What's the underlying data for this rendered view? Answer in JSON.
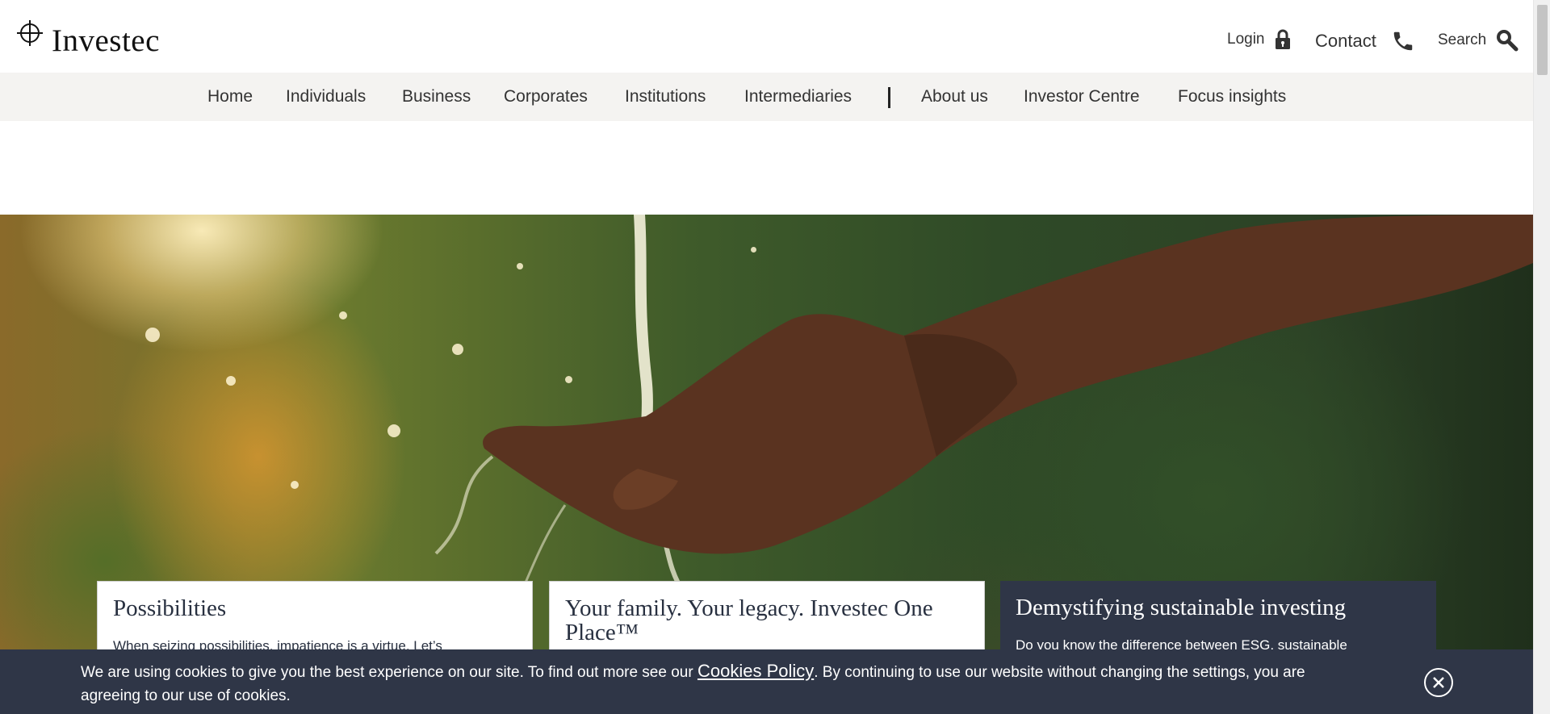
{
  "header": {
    "logo_text": "Investec",
    "login_label": "Login",
    "contact_label": "Contact",
    "search_label": "Search"
  },
  "nav": {
    "items": [
      {
        "label": "Home"
      },
      {
        "label": "Individuals"
      },
      {
        "label": "Business"
      },
      {
        "label": "Corporates"
      },
      {
        "label": "Institutions"
      },
      {
        "label": "Intermediaries"
      },
      {
        "label": "About us"
      },
      {
        "label": "Investor Centre"
      },
      {
        "label": "Focus insights"
      }
    ]
  },
  "cards": [
    {
      "title": "Possibilities",
      "text": "When seizing possibilities, impatience is a virtue. Let’s"
    },
    {
      "title": "Your family. Your legacy. Investec One Place™",
      "text": ""
    },
    {
      "title": "Demystifying sustainable investing",
      "text": "Do you know the difference between ESG, sustainable"
    }
  ],
  "cookie": {
    "text_before": "We are using cookies to give you the best experience on our site. To find out more see our ",
    "link_label": "Cookies Policy",
    "text_after": ". By continuing to use our website without changing the settings, you are agreeing to our use of cookies."
  },
  "colors": {
    "nav_bg": "#f4f3f1",
    "dark_panel": "#2f3647",
    "text_dark": "#283040"
  },
  "icons": [
    "investec-logo-icon",
    "lock-icon",
    "phone-icon",
    "search-icon",
    "close-icon"
  ]
}
